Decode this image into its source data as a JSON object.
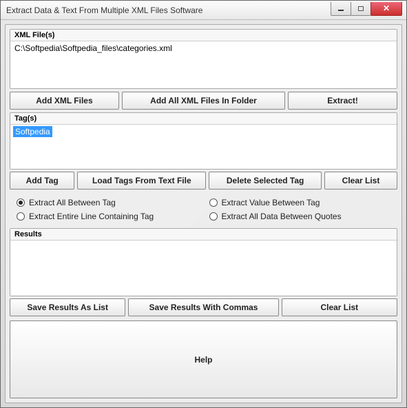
{
  "window": {
    "title": "Extract Data & Text From Multiple XML Files Software"
  },
  "files_group": {
    "label": "XML File(s)",
    "items": [
      "C:\\Softpedia\\Softpedia_files\\categories.xml"
    ],
    "buttons": {
      "add_files": "Add XML Files",
      "add_folder": "Add All XML Files In Folder",
      "extract": "Extract!"
    }
  },
  "tags_group": {
    "label": "Tag(s)",
    "items": [
      "Softpedia"
    ],
    "selected_index": 0,
    "buttons": {
      "add_tag": "Add Tag",
      "load_tags": "Load Tags From Text File",
      "delete_tag": "Delete Selected Tag",
      "clear_list": "Clear List"
    }
  },
  "options": {
    "selected": "extract_all_between",
    "extract_all_between": "Extract All Between Tag",
    "extract_value_between": "Extract Value Between Tag",
    "extract_entire_line": "Extract Entire Line Containing Tag",
    "extract_quotes": "Extract All Data Between Quotes"
  },
  "results_group": {
    "label": "Results",
    "items": [],
    "buttons": {
      "save_list": "Save Results As List",
      "save_commas": "Save Results With Commas",
      "clear_list": "Clear List"
    }
  },
  "help_label": "Help"
}
